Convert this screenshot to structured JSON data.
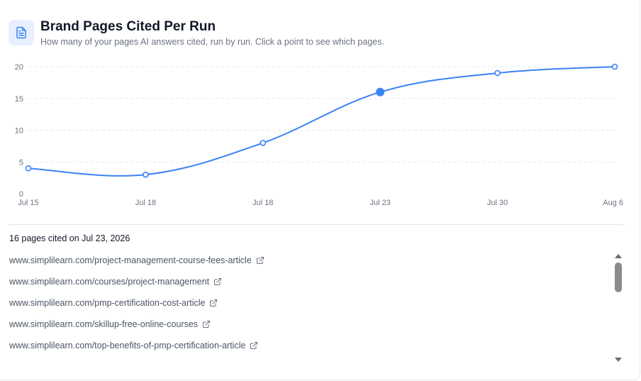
{
  "header": {
    "title": "Brand Pages Cited Per Run",
    "subtitle": "How many of your pages AI answers cited, run by run. Click a point to see which pages.",
    "icon": "document-icon"
  },
  "chart_data": {
    "type": "line",
    "categories": [
      "Jul 15",
      "Jul 18",
      "Jul 18",
      "Jul 23",
      "Jul 30",
      "Aug 6"
    ],
    "values": [
      4,
      3,
      8,
      16,
      19,
      20
    ],
    "selected_index": 3,
    "ylim": [
      0,
      20
    ],
    "yticks": [
      0,
      5,
      10,
      15,
      20
    ],
    "xlabel": "",
    "ylabel": "",
    "grid": true,
    "line_color": "#3b82f6"
  },
  "detail": {
    "heading": "16 pages cited on Jul 23, 2026",
    "pages": [
      "www.simplilearn.com/project-management-course-fees-article",
      "www.simplilearn.com/courses/project-management",
      "www.simplilearn.com/pmp-certification-cost-article",
      "www.simplilearn.com/skillup-free-online-courses",
      "www.simplilearn.com/top-benefits-of-pmp-certification-article"
    ]
  }
}
